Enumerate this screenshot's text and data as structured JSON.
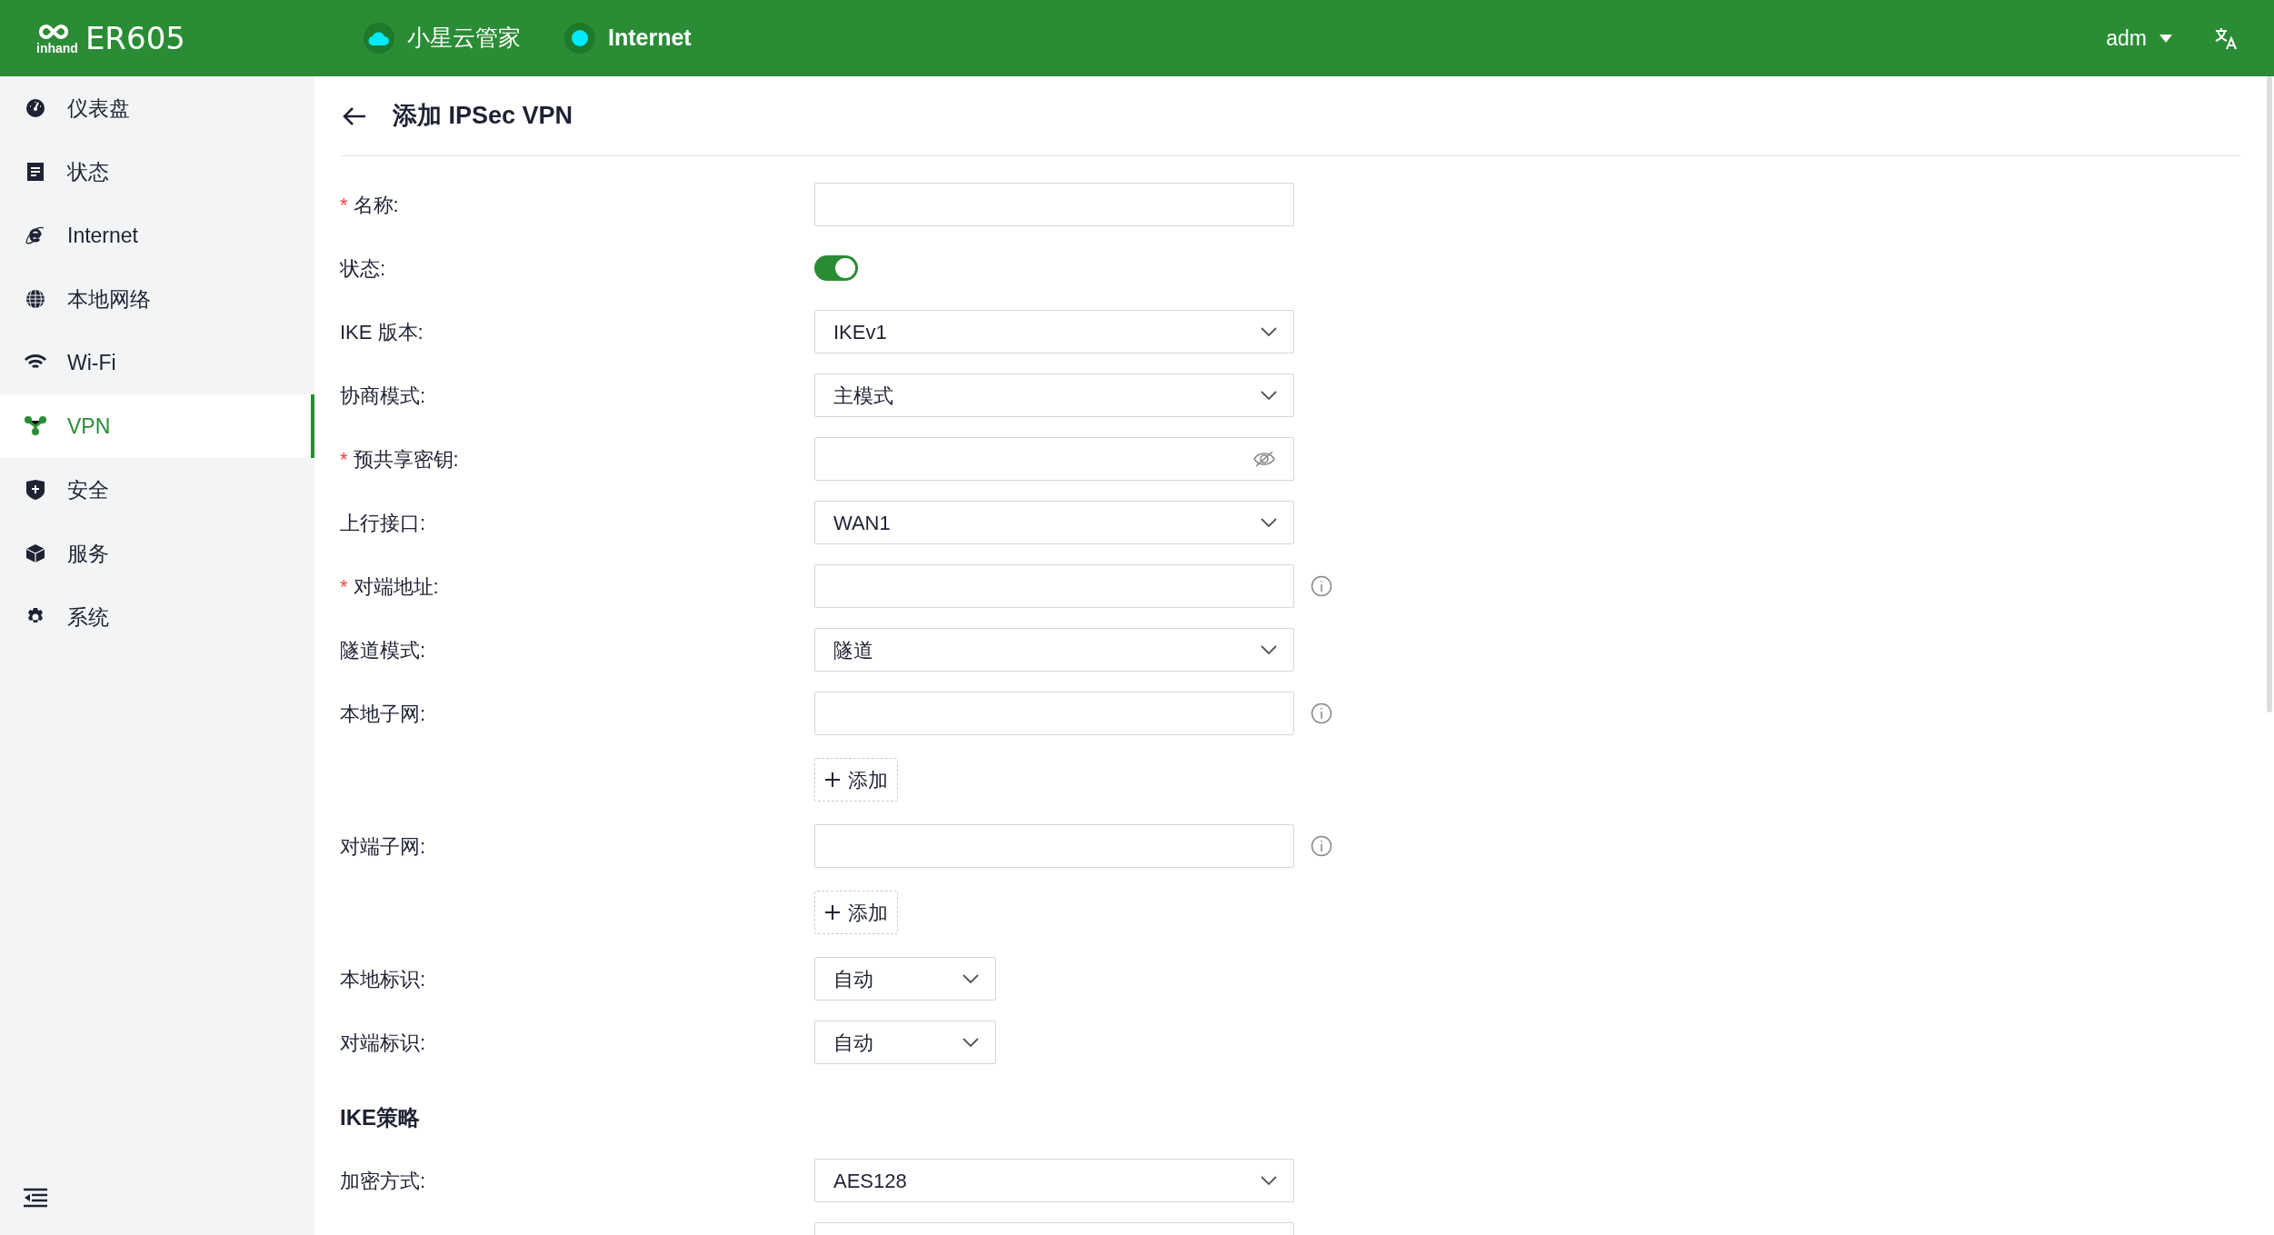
{
  "header": {
    "logo": {
      "brand": "inhand",
      "product": "ER605"
    },
    "status": [
      {
        "kind": "cloud",
        "label": "小星云管家"
      },
      {
        "kind": "dot",
        "label": "Internet"
      }
    ],
    "user": "adm"
  },
  "sidebar": {
    "items": [
      {
        "label": "仪表盘",
        "selected": false
      },
      {
        "label": "状态",
        "selected": false
      },
      {
        "label": "Internet",
        "selected": false
      },
      {
        "label": "本地网络",
        "selected": false
      },
      {
        "label": "Wi-Fi",
        "selected": false
      },
      {
        "label": "VPN",
        "selected": true
      },
      {
        "label": "安全",
        "selected": false
      },
      {
        "label": "服务",
        "selected": false
      },
      {
        "label": "系统",
        "selected": false
      }
    ]
  },
  "page": {
    "title": "添加 IPSec VPN",
    "form": [
      {
        "kind": "input",
        "required_mark": "*",
        "label": "名称:",
        "info": false
      },
      {
        "kind": "switch",
        "label": "状态:",
        "on": true
      },
      {
        "kind": "select",
        "label": "IKE 版本:",
        "value": "IKEv1",
        "compact": false
      },
      {
        "kind": "select",
        "label": "协商模式:",
        "value": "主模式",
        "compact": false
      },
      {
        "kind": "password",
        "required_mark": "*",
        "label": "预共享密钥:"
      },
      {
        "kind": "select",
        "label": "上行接口:",
        "value": "WAN1",
        "compact": false
      },
      {
        "kind": "input",
        "required_mark": "*",
        "label": "对端地址:",
        "info": true
      },
      {
        "kind": "select",
        "label": "隧道模式:",
        "value": "隧道",
        "compact": false
      },
      {
        "kind": "input",
        "label": "本地子网:",
        "info": true
      },
      {
        "kind": "add",
        "label": "添加"
      },
      {
        "kind": "input",
        "label": "对端子网:",
        "info": true
      },
      {
        "kind": "add",
        "label": "添加"
      },
      {
        "kind": "select",
        "label": "本地标识:",
        "value": "自动",
        "compact": true
      },
      {
        "kind": "select",
        "label": "对端标识:",
        "value": "自动",
        "compact": true
      },
      {
        "kind": "section",
        "label": "IKE策略"
      },
      {
        "kind": "select",
        "label": "加密方式:",
        "value": "AES128",
        "compact": false
      },
      {
        "kind": "partial"
      }
    ]
  }
}
